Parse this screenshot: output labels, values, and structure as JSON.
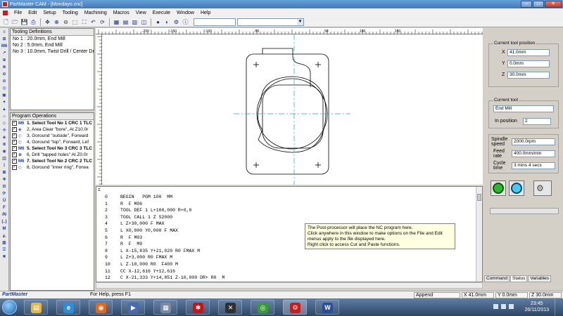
{
  "window": {
    "title": "PartMaster CAM - [Mondayo.cnc]",
    "buttons": {
      "minimize": "–",
      "maximize": "□",
      "close": "✕"
    }
  },
  "menu": [
    "File",
    "Edit",
    "Setup",
    "Tooling",
    "Machining",
    "Macros",
    "View",
    "Execute",
    "Window",
    "Help"
  ],
  "toolbar": {
    "icons": [
      "new-icon",
      "open-icon",
      "save-icon",
      "print-icon",
      "move-icon",
      "zoom-in-icon",
      "zoom-out-icon",
      "zoom-window-icon",
      "zoom-extents-icon",
      "zoom-previous-icon",
      "redraw-icon",
      "view-top-icon",
      "view-front-icon",
      "view-side-icon",
      "view-iso-icon",
      "run-icon",
      "simulate-icon",
      "setup-icon",
      "info-icon"
    ],
    "glyphs": [
      "🗋",
      "🗁",
      "💾",
      "⎙",
      "✥",
      "⊕",
      "⊖",
      "⬚",
      "⛶",
      "↶",
      "⟳",
      "▦",
      "▤",
      "▥",
      "◫",
      "●",
      "◐",
      "⚙",
      "ⓘ"
    ],
    "combo1": "",
    "combo2": ""
  },
  "left_strip": [
    "≡",
    "⊞",
    "M6",
    "↗",
    "⊕",
    "⊗",
    "⊖",
    "⊘",
    "◎",
    "▣",
    "✦",
    "▲",
    "⌂",
    "◇",
    "✣",
    "◈",
    "⊛",
    "◉",
    "▥",
    "⋮",
    "⊠",
    "✚",
    "⊡",
    "⟳",
    "Ü",
    "F",
    "/N",
    "(..)",
    "M",
    "◭",
    "▩",
    "☰",
    "✖"
  ],
  "tooling": {
    "header": "Tooling Definitions",
    "items": [
      "No 1 : 20.0mm, End Mill",
      "No 2 : 5.0mm, End Mill",
      "No 3 : 10.0mm, Twist Drill / Center Dr"
    ]
  },
  "operations": {
    "header": "Program Operations",
    "items": [
      {
        "icon": "M6",
        "text": "1. Select Tool No 1 CRC 1 TLC",
        "bold": true
      },
      {
        "icon": "◈",
        "text": "2, Area Clear \"bore\", At Z10.0r",
        "bold": false
      },
      {
        "icon": "◇",
        "text": "3, Goround \"outside\", Forward",
        "bold": false
      },
      {
        "icon": "◇",
        "text": "4, Goround \"top\", Forward, Lef",
        "bold": false
      },
      {
        "icon": "M6",
        "text": "5. Select Tool No 3 CRC 3 TLC",
        "bold": true
      },
      {
        "icon": "⊕",
        "text": "6, Drill \"tapped holes\" At Z0.0r",
        "bold": false
      },
      {
        "icon": "M6",
        "text": "7. Select Tool No 2 CRC 2 TLC",
        "bold": true
      },
      {
        "icon": "◇",
        "text": "8, Goround \"inner ring\", Forwa",
        "bold": false
      }
    ]
  },
  "ruler": {
    "top_labels": [
      "-200",
      "-150",
      "-100",
      "-50",
      "50",
      "100",
      "150"
    ]
  },
  "nc": {
    "lines": [
      {
        "n": "0",
        "code": "BEGIN   PGM 100  MM"
      },
      {
        "n": "1",
        "code": "R  F M06"
      },
      {
        "n": "2",
        "code": "TOOL DEF 1 L+100,000 R+0,0"
      },
      {
        "n": "3",
        "code": "TOOL CALL 1 Z S2000"
      },
      {
        "n": "4",
        "code": "L Z+30,000 F MAX"
      },
      {
        "n": "5",
        "code": "L X0,000 Y0,000 F MAX"
      },
      {
        "n": "6",
        "code": "R  F M03"
      },
      {
        "n": "7",
        "code": "R  F  M9"
      },
      {
        "n": "8",
        "code": "L X-15,835 Y+21,020 R0 FMAX M"
      },
      {
        "n": "9",
        "code": "L Z+3,000 R0 FMAX M"
      },
      {
        "n": "10",
        "code": "L Z-10,000 R0  F400 M"
      },
      {
        "n": "11",
        "code": "CC X-12,616 Y+12,616"
      },
      {
        "n": "12",
        "code": "C X-21,333 Y+14,851 Z-10,000 DR+ R0  M"
      }
    ],
    "tooltip": [
      "The Post-processor will place the NC program here.",
      "Click anywhere in this window to make options on the File and Edit menus apply to the file displayed here.",
      "Right click to access Cut and Paste functions."
    ]
  },
  "right_panel": {
    "position_group": "Current tool position",
    "x_label": "X",
    "x_value": "41.0mm",
    "y_label": "Y",
    "y_value": "0.0mm",
    "z_label": "Z",
    "z_value": "30.0mm",
    "tool_group": "Current tool",
    "tool_name": "End Mill",
    "in_position_label": "In position",
    "in_position_value": "2",
    "spindle_label": "Spindle\nspeed",
    "spindle_value": "2000.0rpm",
    "feed_label": "Feed\nrate",
    "feed_value": "400.0mm/min",
    "cycle_label": "Cycle\ntime",
    "cycle_value": "3 mins 4 secs",
    "tabs": [
      "Command",
      "Status",
      "Variables"
    ],
    "active_tab": "Status"
  },
  "status": {
    "brand": "PartMaster",
    "help": "For Help, press F1",
    "mode": "Append",
    "x": "X  41.0mm",
    "y": "Y  0.0mm",
    "z": "Z  30.0mm"
  },
  "taskbar": {
    "apps": [
      {
        "name": "explorer-app",
        "glyph": "▤",
        "color": "#e6b84a"
      },
      {
        "name": "ie-app",
        "glyph": "e",
        "color": "#2a8fd8"
      },
      {
        "name": "firefox-app",
        "glyph": "◉",
        "color": "#e06a1a"
      },
      {
        "name": "media-app",
        "glyph": "▶",
        "color": "#4a6ab0"
      },
      {
        "name": "calculator-app",
        "glyph": "▦",
        "color": "#7a8aa0"
      },
      {
        "name": "cad-app",
        "glyph": "✱",
        "color": "#c01818"
      },
      {
        "name": "tools-app",
        "glyph": "✕",
        "color": "#303030"
      },
      {
        "name": "chrome-app",
        "glyph": "◎",
        "color": "#3a9a3a"
      },
      {
        "name": "partmaster-app",
        "glyph": "⚙",
        "color": "#c02020"
      },
      {
        "name": "word-app",
        "glyph": "W",
        "color": "#2a4f9a"
      }
    ],
    "time": "23:45",
    "date": "26/11/2013"
  }
}
